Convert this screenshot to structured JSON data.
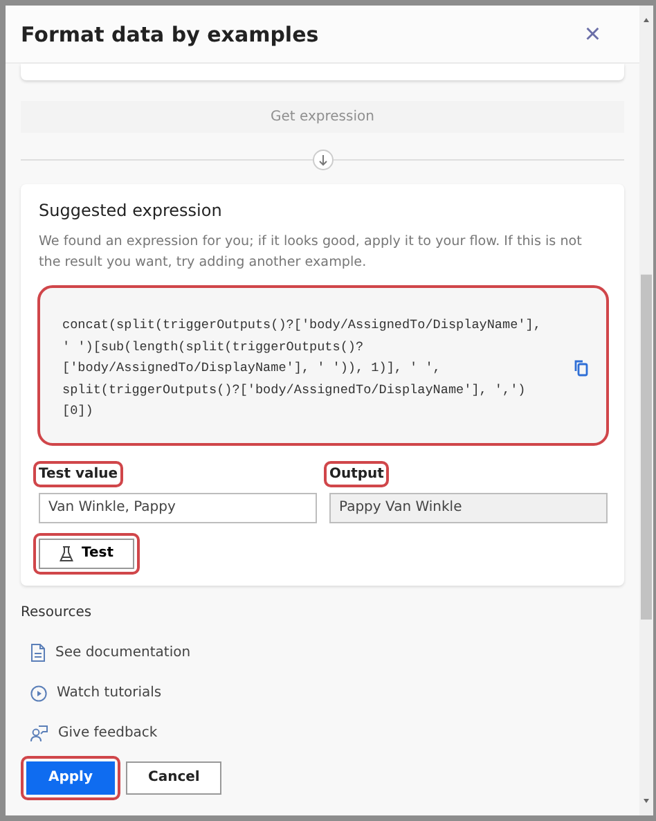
{
  "window": {
    "title": "Format data by examples",
    "close": "×"
  },
  "get_expression": {
    "label": "Get expression",
    "disabled": true
  },
  "suggestion": {
    "title": "Suggested expression",
    "description": "We found an expression for you; if it looks good, apply it to your flow. If this is not the result you want, try adding another example.",
    "code": "concat(split(triggerOutputs()?['body/AssignedTo/DisplayName'],\n' ')[sub(length(split(triggerOutputs()?\n['body/AssignedTo/DisplayName'], ' ')), 1)], ' ',\nsplit(triggerOutputs()?['body/AssignedTo/DisplayName'], ',')\n[0])",
    "highlighted": true
  },
  "fields": [
    {
      "label": "Test value",
      "value": "Van Winkle, Pappy",
      "disabled": false,
      "highlighted": true
    },
    {
      "label": "Output",
      "value": "Pappy Van Winkle",
      "disabled": true,
      "highlighted": true
    }
  ],
  "test_button": {
    "label": "Test",
    "highlighted": true
  },
  "resources": {
    "title": "Resources",
    "links": [
      {
        "label": "See documentation",
        "kind": "doc"
      },
      {
        "label": "Watch tutorials",
        "kind": "video"
      },
      {
        "label": "Give feedback",
        "kind": "feedback"
      }
    ]
  },
  "footer": [
    {
      "label": "Apply",
      "kind": "primary",
      "highlighted": true
    },
    {
      "label": "Cancel",
      "kind": "secondary",
      "highlighted": false
    }
  ]
}
